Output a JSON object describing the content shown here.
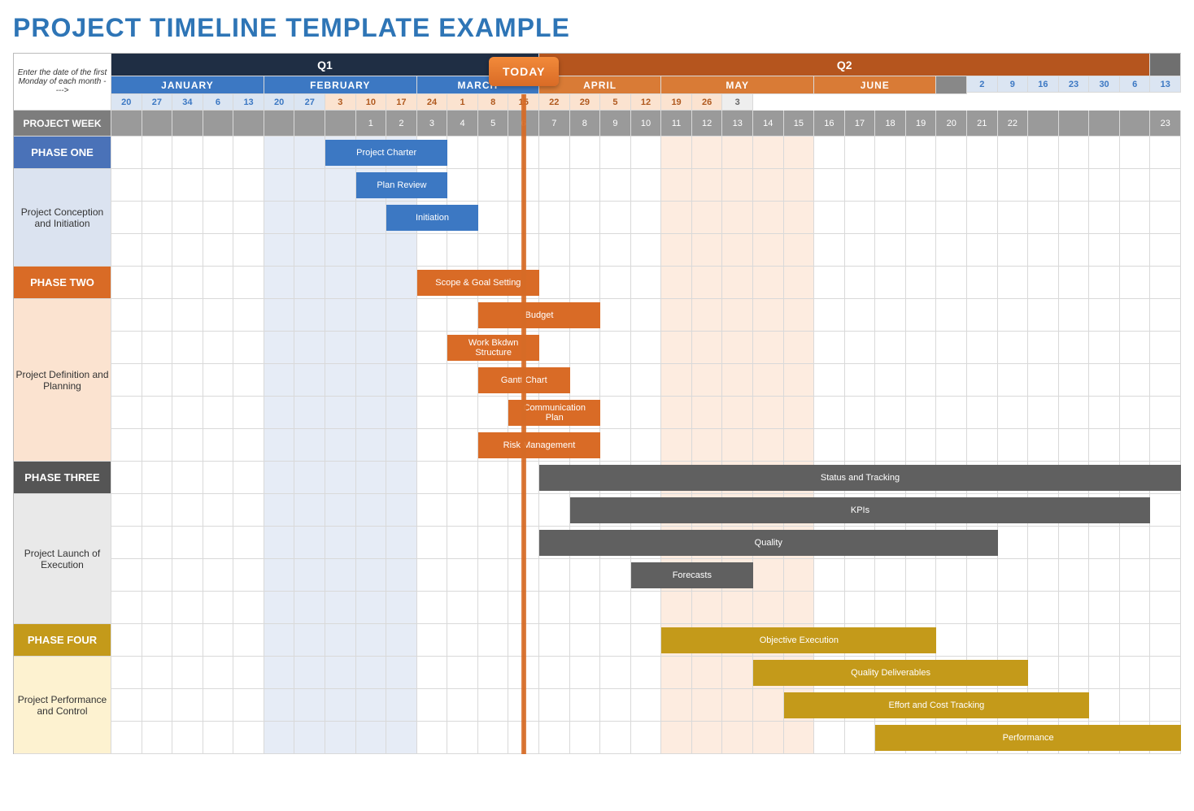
{
  "title": "PROJECT TIMELINE TEMPLATE EXAMPLE",
  "corner_note": "Enter the date of the first Monday of each month ---->",
  "today_label": "TODAY",
  "project_week_label": "PROJECT WEEK",
  "today_column_index": 14,
  "quarters": [
    {
      "label": "Q1",
      "span": 14,
      "class": "q1"
    },
    {
      "label": "Q2",
      "span": 20,
      "class": "q2"
    },
    {
      "label": "",
      "span": 1,
      "class": "qx"
    }
  ],
  "months": [
    {
      "label": "JANUARY",
      "class": "m-jan",
      "days": [
        "2",
        "9",
        "16",
        "23",
        "30"
      ]
    },
    {
      "label": "FEBRUARY",
      "class": "m-feb",
      "days": [
        "6",
        "13",
        "20",
        "27",
        "34"
      ]
    },
    {
      "label": "MARCH",
      "class": "m-mar",
      "days": [
        "6",
        "13",
        "20",
        "27"
      ]
    },
    {
      "label": "APRIL",
      "class": "m-apr",
      "days": [
        "3",
        "10",
        "17",
        "24"
      ]
    },
    {
      "label": "MAY",
      "class": "m-may",
      "days": [
        "1",
        "8",
        "15",
        "22",
        "29"
      ]
    },
    {
      "label": "JUNE",
      "class": "m-jun",
      "days": [
        "5",
        "12",
        "19",
        "26"
      ]
    },
    {
      "label": "",
      "class": "m-jul",
      "days": [
        "3"
      ]
    }
  ],
  "day_first_month_index": 14,
  "weeks": [
    "",
    "",
    "",
    "",
    "",
    "",
    "",
    "",
    "1",
    "2",
    "3",
    "4",
    "5",
    "6",
    "7",
    "8",
    "9",
    "10",
    "11",
    "12",
    "13",
    "14",
    "15",
    "16",
    "17",
    "18",
    "19",
    "20",
    "21",
    "22",
    "",
    "",
    "",
    "",
    "23"
  ],
  "tint_blue_cols": [
    5,
    6,
    7,
    8,
    9
  ],
  "tint_orange_cols": [
    18,
    19,
    20,
    21,
    22
  ],
  "phases": [
    {
      "header": "PHASE ONE",
      "header_class": "ph1",
      "body_class": "ph1-body",
      "group_label": "Project Conception and Initiation",
      "rows": 4,
      "tasks": [
        {
          "row": 0,
          "label": "Project Charter",
          "start": 8,
          "end": 11,
          "color": "blue"
        },
        {
          "row": 1,
          "label": "Plan Review",
          "start": 9,
          "end": 11,
          "color": "blue"
        },
        {
          "row": 2,
          "label": "Initiation",
          "start": 10,
          "end": 12,
          "color": "blue"
        }
      ]
    },
    {
      "header": "PHASE TWO",
      "header_class": "ph2",
      "body_class": "ph2-body",
      "group_label": "Project Definition and Planning",
      "rows": 6,
      "tasks": [
        {
          "row": 0,
          "label": "Scope & Goal Setting",
          "start": 11,
          "end": 14,
          "color": "orange"
        },
        {
          "row": 1,
          "label": "Budget",
          "start": 13,
          "end": 16,
          "color": "orange"
        },
        {
          "row": 2,
          "label": "Work Bkdwn Structure",
          "start": 12,
          "end": 14,
          "color": "orange"
        },
        {
          "row": 3,
          "label": "Gantt Chart",
          "start": 13,
          "end": 15,
          "color": "orange"
        },
        {
          "row": 4,
          "label": "Communication Plan",
          "start": 14,
          "end": 16,
          "color": "orange"
        },
        {
          "row": 5,
          "label": "Risk Management",
          "start": 13,
          "end": 16,
          "color": "orange"
        }
      ]
    },
    {
      "header": "PHASE THREE",
      "header_class": "ph3",
      "body_class": "ph3-body",
      "group_label": "Project Launch of Execution",
      "rows": 5,
      "tasks": [
        {
          "row": 0,
          "label": "Status  and Tracking",
          "start": 15,
          "end": 35,
          "color": "gray"
        },
        {
          "row": 1,
          "label": "KPIs",
          "start": 16,
          "end": 34,
          "color": "gray"
        },
        {
          "row": 2,
          "label": "Quality",
          "start": 15,
          "end": 29,
          "color": "gray"
        },
        {
          "row": 3,
          "label": "Forecasts",
          "start": 18,
          "end": 21,
          "color": "gray"
        }
      ]
    },
    {
      "header": "PHASE FOUR",
      "header_class": "ph4",
      "body_class": "ph4-body",
      "group_label": "Project Performance and Control",
      "rows": 4,
      "tasks": [
        {
          "row": 0,
          "label": "Objective Execution",
          "start": 19,
          "end": 27,
          "color": "gold"
        },
        {
          "row": 1,
          "label": "Quality Deliverables",
          "start": 22,
          "end": 30,
          "color": "gold"
        },
        {
          "row": 2,
          "label": "Effort and Cost Tracking",
          "start": 23,
          "end": 32,
          "color": "gold"
        },
        {
          "row": 3,
          "label": "Performance",
          "start": 26,
          "end": 35,
          "color": "gold"
        }
      ]
    }
  ],
  "chart_data": {
    "type": "gantt",
    "title": "PROJECT TIMELINE TEMPLATE EXAMPLE",
    "x_unit": "week-column (1-based index along timeline)",
    "x_range": [
      1,
      35
    ],
    "today_x": 14,
    "columns_per_month": {
      "Jan": 5,
      "Feb": 5,
      "Mar": 4,
      "Apr": 4,
      "May": 5,
      "Jun": 4,
      "Jul": 1
    },
    "series": [
      {
        "phase": "PHASE ONE",
        "task": "Project Charter",
        "start": 8,
        "end": 11
      },
      {
        "phase": "PHASE ONE",
        "task": "Plan Review",
        "start": 9,
        "end": 11
      },
      {
        "phase": "PHASE ONE",
        "task": "Initiation",
        "start": 10,
        "end": 12
      },
      {
        "phase": "PHASE TWO",
        "task": "Scope & Goal Setting",
        "start": 11,
        "end": 14
      },
      {
        "phase": "PHASE TWO",
        "task": "Budget",
        "start": 13,
        "end": 16
      },
      {
        "phase": "PHASE TWO",
        "task": "Work Bkdwn Structure",
        "start": 12,
        "end": 14
      },
      {
        "phase": "PHASE TWO",
        "task": "Gantt Chart",
        "start": 13,
        "end": 15
      },
      {
        "phase": "PHASE TWO",
        "task": "Communication Plan",
        "start": 14,
        "end": 16
      },
      {
        "phase": "PHASE TWO",
        "task": "Risk Management",
        "start": 13,
        "end": 16
      },
      {
        "phase": "PHASE THREE",
        "task": "Status and Tracking",
        "start": 15,
        "end": 35
      },
      {
        "phase": "PHASE THREE",
        "task": "KPIs",
        "start": 16,
        "end": 34
      },
      {
        "phase": "PHASE THREE",
        "task": "Quality",
        "start": 15,
        "end": 29
      },
      {
        "phase": "PHASE THREE",
        "task": "Forecasts",
        "start": 18,
        "end": 21
      },
      {
        "phase": "PHASE FOUR",
        "task": "Objective Execution",
        "start": 19,
        "end": 27
      },
      {
        "phase": "PHASE FOUR",
        "task": "Quality Deliverables",
        "start": 22,
        "end": 30
      },
      {
        "phase": "PHASE FOUR",
        "task": "Effort and Cost Tracking",
        "start": 23,
        "end": 32
      },
      {
        "phase": "PHASE FOUR",
        "task": "Performance",
        "start": 26,
        "end": 35
      }
    ]
  }
}
